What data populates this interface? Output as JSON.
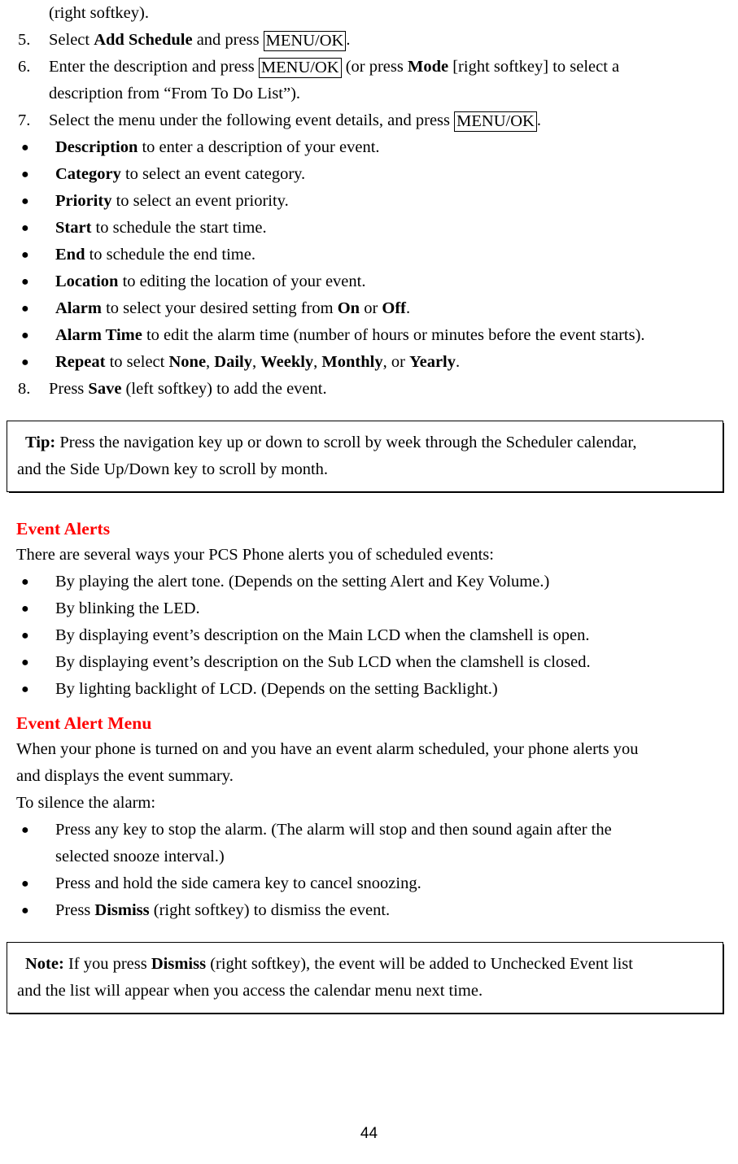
{
  "document": {
    "page_number": "44",
    "accent_color": "#FF0000"
  },
  "intro_continuation": "(right softkey).",
  "steps": [
    {
      "number": "5.",
      "parts": [
        {
          "t": "Select ",
          "style": "normal"
        },
        {
          "t": "Add Schedule",
          "style": "bold"
        },
        {
          "t": " and press ",
          "style": "normal"
        },
        {
          "t": "MENU/OK",
          "style": "keybox"
        },
        {
          "t": ".",
          "style": "normal"
        }
      ]
    },
    {
      "number": "6.",
      "parts": [
        {
          "t": "Enter the description and press ",
          "style": "normal"
        },
        {
          "t": "MENU/OK",
          "style": "keybox"
        },
        {
          "t": " (or press ",
          "style": "normal"
        },
        {
          "t": "Mode",
          "style": "bold"
        },
        {
          "t": " [right softkey] to select a",
          "style": "normal"
        }
      ],
      "continuation": "description from “From To Do List”)."
    },
    {
      "number": "7.",
      "parts": [
        {
          "t": "Select the menu under the following event details, and press ",
          "style": "normal"
        },
        {
          "t": "MENU/OK",
          "style": "keybox"
        },
        {
          "t": ".",
          "style": "normal"
        }
      ]
    }
  ],
  "detail_bullets": [
    {
      "parts": [
        {
          "t": "Description",
          "style": "bold"
        },
        {
          "t": " to enter a description of your event.",
          "style": "normal"
        }
      ]
    },
    {
      "parts": [
        {
          "t": "Category",
          "style": "bold"
        },
        {
          "t": " to select an event category.",
          "style": "normal"
        }
      ]
    },
    {
      "parts": [
        {
          "t": "Priority",
          "style": "bold"
        },
        {
          "t": " to select an event priority.",
          "style": "normal"
        }
      ]
    },
    {
      "parts": [
        {
          "t": "Start",
          "style": "bold"
        },
        {
          "t": " to schedule the start time.",
          "style": "normal"
        }
      ]
    },
    {
      "parts": [
        {
          "t": "End",
          "style": "bold"
        },
        {
          "t": " to schedule the end time.",
          "style": "normal"
        }
      ]
    },
    {
      "parts": [
        {
          "t": "Location",
          "style": "bold"
        },
        {
          "t": " to editing the location of your event.",
          "style": "normal"
        }
      ]
    },
    {
      "parts": [
        {
          "t": "Alarm",
          "style": "bold"
        },
        {
          "t": " to select your desired setting from ",
          "style": "normal"
        },
        {
          "t": "On",
          "style": "bold"
        },
        {
          "t": " or ",
          "style": "normal"
        },
        {
          "t": "Off",
          "style": "bold"
        },
        {
          "t": ".",
          "style": "normal"
        }
      ]
    },
    {
      "parts": [
        {
          "t": "Alarm Time",
          "style": "bold"
        },
        {
          "t": " to edit the alarm time (number of hours or minutes before the event starts).",
          "style": "normal"
        }
      ]
    },
    {
      "parts": [
        {
          "t": "Repeat",
          "style": "bold"
        },
        {
          "t": " to select ",
          "style": "normal"
        },
        {
          "t": "None",
          "style": "bold"
        },
        {
          "t": ", ",
          "style": "normal"
        },
        {
          "t": "Daily",
          "style": "bold"
        },
        {
          "t": ", ",
          "style": "normal"
        },
        {
          "t": "Weekly",
          "style": "bold"
        },
        {
          "t": ", ",
          "style": "normal"
        },
        {
          "t": "Monthly",
          "style": "bold"
        },
        {
          "t": ", or ",
          "style": "normal"
        },
        {
          "t": "Yearly",
          "style": "bold"
        },
        {
          "t": ".",
          "style": "normal"
        }
      ]
    }
  ],
  "step8": {
    "number": "8.",
    "parts": [
      {
        "t": "Press ",
        "style": "normal"
      },
      {
        "t": "Save",
        "style": "bold"
      },
      {
        "t": " (left softkey) to add the event.",
        "style": "normal"
      }
    ]
  },
  "tip_box": {
    "label": "Tip:",
    "line1": " Press the navigation key up or down to scroll by week through the Scheduler calendar,",
    "line2": "and the Side Up/Down key to scroll by month."
  },
  "event_alerts": {
    "heading": "Event Alerts",
    "intro": "There are several ways your PCS Phone alerts you of scheduled events:",
    "bullets": [
      "By playing the alert tone. (Depends on the setting Alert and Key Volume.)",
      "By blinking the LED.",
      "By displaying event’s description on the Main LCD when the clamshell is open.",
      "By displaying event’s description on the Sub LCD when the clamshell is closed.",
      "By lighting backlight of LCD. (Depends on the setting Backlight.)"
    ]
  },
  "event_alert_menu": {
    "heading": "Event Alert Menu",
    "para_line1": "When your phone is turned on and you have an event alarm scheduled, your phone alerts you",
    "para_line2": "and displays the event summary.",
    "para_line3": "To silence the alarm:",
    "bullets": [
      {
        "parts": [
          {
            "t": "Press any key to stop the alarm. (The alarm will stop and then sound again after the",
            "style": "normal"
          }
        ],
        "continuation": "selected snooze interval.)"
      },
      {
        "parts": [
          {
            "t": "Press and hold the side camera key to cancel snoozing.",
            "style": "normal"
          }
        ]
      },
      {
        "parts": [
          {
            "t": "Press ",
            "style": "normal"
          },
          {
            "t": "Dismiss",
            "style": "bold"
          },
          {
            "t": " (right softkey) to dismiss the event.",
            "style": "normal"
          }
        ]
      }
    ]
  },
  "note_box": {
    "label": "Note:",
    "line1_parts": [
      {
        "t": " If you press ",
        "style": "normal"
      },
      {
        "t": "Dismiss",
        "style": "bold"
      },
      {
        "t": " (right softkey), the event will be added to Unchecked Event list",
        "style": "normal"
      }
    ],
    "line2": "and the list will appear when you access the calendar menu next time."
  },
  "icons": {
    "bullet": "●"
  }
}
